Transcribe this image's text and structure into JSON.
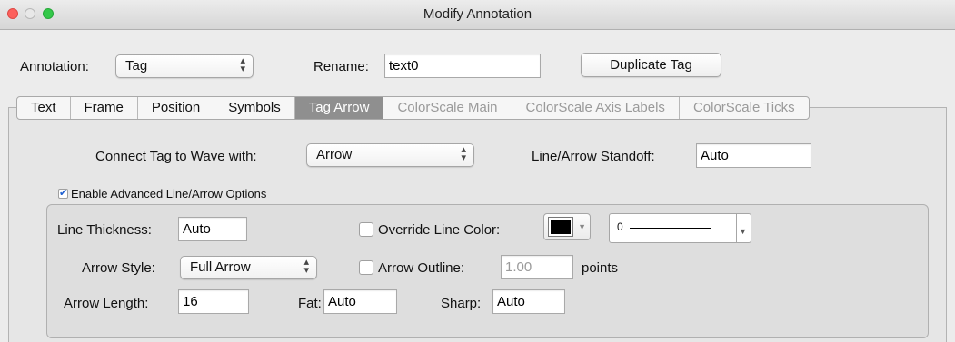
{
  "window": {
    "title": "Modify Annotation"
  },
  "annotation": {
    "label": "Annotation:",
    "selected": "Tag"
  },
  "rename": {
    "label": "Rename:",
    "value": "text0"
  },
  "duplicate_button": "Duplicate Tag",
  "tabs": [
    {
      "label": "Text",
      "state": "normal"
    },
    {
      "label": "Frame",
      "state": "normal"
    },
    {
      "label": "Position",
      "state": "normal"
    },
    {
      "label": "Symbols",
      "state": "normal"
    },
    {
      "label": "Tag Arrow",
      "state": "active"
    },
    {
      "label": "ColorScale Main",
      "state": "disabled"
    },
    {
      "label": "ColorScale Axis Labels",
      "state": "disabled"
    },
    {
      "label": "ColorScale Ticks",
      "state": "disabled"
    }
  ],
  "connect": {
    "label": "Connect Tag to Wave with:",
    "selected": "Arrow"
  },
  "standoff": {
    "label": "Line/Arrow Standoff:",
    "value": "Auto"
  },
  "advanced": {
    "label": "Enable Advanced Line/Arrow Options",
    "checked": true
  },
  "line_thickness": {
    "label": "Line Thickness:",
    "value": "Auto"
  },
  "override_color": {
    "label": "Override Line Color:",
    "checked": false,
    "swatch_color": "#000000"
  },
  "line_style": {
    "value": "0"
  },
  "arrow_style": {
    "label": "Arrow Style:",
    "selected": "Full Arrow"
  },
  "arrow_outline": {
    "label": "Arrow Outline:",
    "checked": false,
    "value": "1.00",
    "unit": "points"
  },
  "arrow_length": {
    "label": "Arrow Length:",
    "value": "16"
  },
  "fat": {
    "label": "Fat:",
    "value": "Auto"
  },
  "sharp": {
    "label": "Sharp:",
    "value": "Auto"
  },
  "icons": {
    "checkbox_checked": "checkmark-icon",
    "popup_arrows": "updown-chevron-icon",
    "dropdown": "chevron-down-icon"
  },
  "colors": {
    "active_tab": "#8f8f8f",
    "close_light": "#fc605c",
    "zoom_light": "#34c84a"
  }
}
